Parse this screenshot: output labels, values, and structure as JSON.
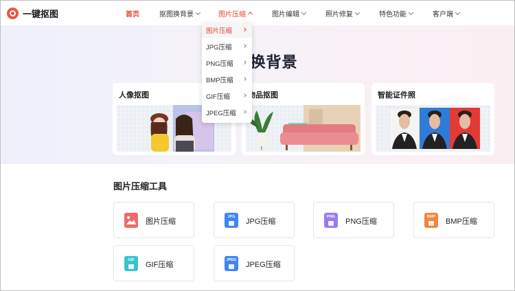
{
  "logo": {
    "text": "一键抠图"
  },
  "nav": {
    "items": [
      {
        "label": "首页",
        "state": "active"
      },
      {
        "label": "抠图换背景",
        "state": "menu"
      },
      {
        "label": "图片压缩",
        "state": "open"
      },
      {
        "label": "图片编辑",
        "state": "menu"
      },
      {
        "label": "照片修复",
        "state": "menu"
      },
      {
        "label": "特色功能",
        "state": "menu"
      },
      {
        "label": "客户端",
        "state": "menu"
      }
    ]
  },
  "dropdown": {
    "items": [
      "图片压缩",
      "JPG压缩",
      "PNG压缩",
      "BMP压缩",
      "GIF压缩",
      "JPEG压缩"
    ],
    "highlighted_index": 0
  },
  "hero": {
    "title": "抠图换背景",
    "cards": [
      {
        "title": "人像抠图"
      },
      {
        "title": "物品抠图"
      },
      {
        "title": "智能证件照"
      }
    ]
  },
  "tools": {
    "title": "图片压缩工具",
    "items": [
      {
        "label": "图片压缩",
        "icon": "image-compress-icon",
        "badge": "",
        "color": "#f06a6a"
      },
      {
        "label": "JPG压缩",
        "icon": "jpg-file-icon",
        "badge": "JPG",
        "color": "#3f86f5"
      },
      {
        "label": "PNG压缩",
        "icon": "png-file-icon",
        "badge": "PNG",
        "color": "#9a7cf0"
      },
      {
        "label": "BMP压缩",
        "icon": "bmp-file-icon",
        "badge": "BMP",
        "color": "#f5843a"
      },
      {
        "label": "GIF压缩",
        "icon": "gif-file-icon",
        "badge": "GIF",
        "color": "#36c5cf"
      },
      {
        "label": "JPEG压缩",
        "icon": "jpeg-file-icon",
        "badge": "JPEG",
        "color": "#3f86f5"
      }
    ]
  },
  "colors": {
    "accent": "#e8432f"
  }
}
